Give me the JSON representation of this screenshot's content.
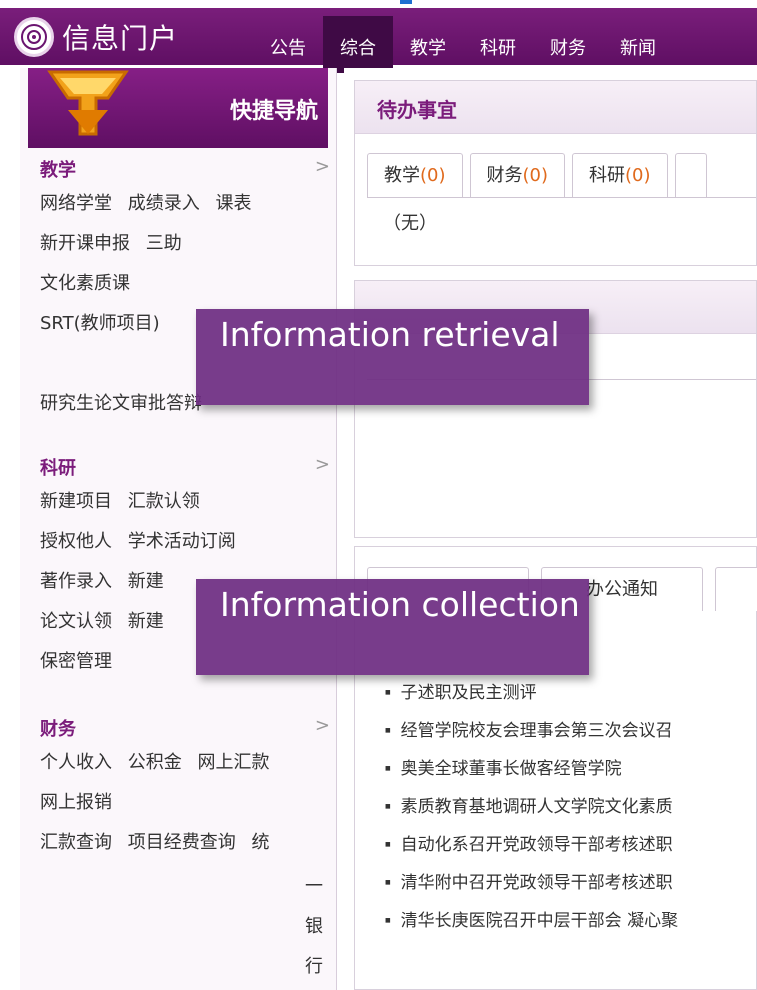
{
  "header": {
    "title": "信息门户",
    "nav": [
      "公告",
      "综合",
      "教学",
      "科研",
      "财务",
      "新闻"
    ],
    "active_nav": "综合"
  },
  "sidebar": {
    "title": "快捷导航",
    "sections": {
      "teaching": {
        "title": "教学",
        "rows": [
          [
            "网络学堂",
            "成绩录入",
            "课表"
          ],
          [
            "新开课申报",
            "三助"
          ],
          [
            "文化素质课"
          ],
          [
            "SRT(教师项目)"
          ],
          [],
          [
            "研究生论文审批答辩"
          ]
        ]
      },
      "research": {
        "title": "科研",
        "rows": [
          [
            "新建项目",
            "汇款认领"
          ],
          [
            "授权他人",
            "学术活动订阅"
          ],
          [
            "著作录入",
            "新建"
          ],
          [
            "论文认领",
            "新建"
          ],
          [
            "保密管理"
          ]
        ]
      },
      "finance": {
        "title": "财务",
        "rows": [
          [
            "个人收入",
            "公积金",
            "网上汇款"
          ],
          [
            "网上报销"
          ],
          [
            "汇款查询",
            "项目经费查询",
            "统"
          ]
        ],
        "overflow_chars": [
          "一",
          "银",
          "行"
        ]
      }
    },
    "chevron": ">"
  },
  "todo": {
    "title": "待办事宜",
    "tabs": [
      {
        "label": "教学",
        "count": "(0)"
      },
      {
        "label": "财务",
        "count": "(0)"
      },
      {
        "label": "科研",
        "count": "(0)"
      }
    ],
    "empty_text": "（无）"
  },
  "news": {
    "tab_partial": "办公通知",
    "items": [
      "子述职及民主测评",
      "经管学院校友会理事会第三次会议召",
      "奥美全球董事长做客经管学院",
      "素质教育基地调研人文学院文化素质",
      "自动化系召开党政领导干部考核述职",
      "清华附中召开党政领导干部考核述职",
      "清华长庚医院召开中层干部会 凝心聚"
    ]
  },
  "overlays": {
    "retrieval": "Information retrieval",
    "collection": "Information collection"
  },
  "colors": {
    "header": "#6a1570",
    "accent": "#7b1c7b",
    "count": "#e06a1d",
    "overlay": "#6e2d82"
  }
}
